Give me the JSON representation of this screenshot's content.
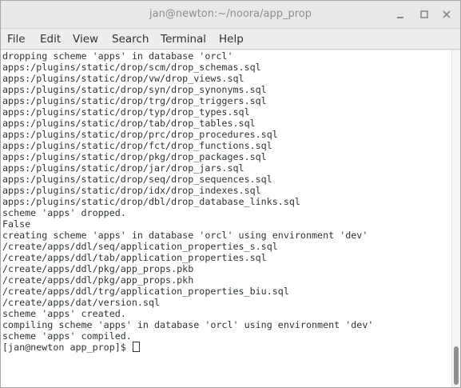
{
  "window": {
    "title": "jan@newton:~/noora/app_prop"
  },
  "menu": {
    "items": [
      {
        "id": "file",
        "label": "File"
      },
      {
        "id": "edit",
        "label": "Edit"
      },
      {
        "id": "view",
        "label": "View"
      },
      {
        "id": "search",
        "label": "Search"
      },
      {
        "id": "terminal",
        "label": "Terminal"
      },
      {
        "id": "help",
        "label": "Help"
      }
    ]
  },
  "terminal": {
    "lines": [
      "dropping scheme 'apps' in database 'orcl'",
      "apps:/plugins/static/drop/scm/drop_schemas.sql",
      "apps:/plugins/static/drop/vw/drop_views.sql",
      "apps:/plugins/static/drop/syn/drop_synonyms.sql",
      "apps:/plugins/static/drop/trg/drop_triggers.sql",
      "apps:/plugins/static/drop/typ/drop_types.sql",
      "apps:/plugins/static/drop/tab/drop_tables.sql",
      "apps:/plugins/static/drop/prc/drop_procedures.sql",
      "apps:/plugins/static/drop/fct/drop_functions.sql",
      "apps:/plugins/static/drop/pkg/drop_packages.sql",
      "apps:/plugins/static/drop/jar/drop_jars.sql",
      "apps:/plugins/static/drop/seq/drop_sequences.sql",
      "apps:/plugins/static/drop/idx/drop_indexes.sql",
      "apps:/plugins/static/drop/dbl/drop_database_links.sql",
      "scheme 'apps' dropped.",
      "False",
      "creating scheme 'apps' in database 'orcl' using environment 'dev'",
      "/create/apps/ddl/seq/application_properties_s.sql",
      "/create/apps/ddl/tab/application_properties.sql",
      "/create/apps/ddl/pkg/app_props.pkb",
      "/create/apps/ddl/pkg/app_props.pkh",
      "/create/apps/ddl/trg/application_properties_biu.sql",
      "/create/apps/dat/version.sql",
      "scheme 'apps' created.",
      "compiling scheme 'apps' in database 'orcl' using environment 'dev'",
      "scheme 'apps' compiled."
    ],
    "prompt": "[jan@newton app_prop]$ "
  }
}
